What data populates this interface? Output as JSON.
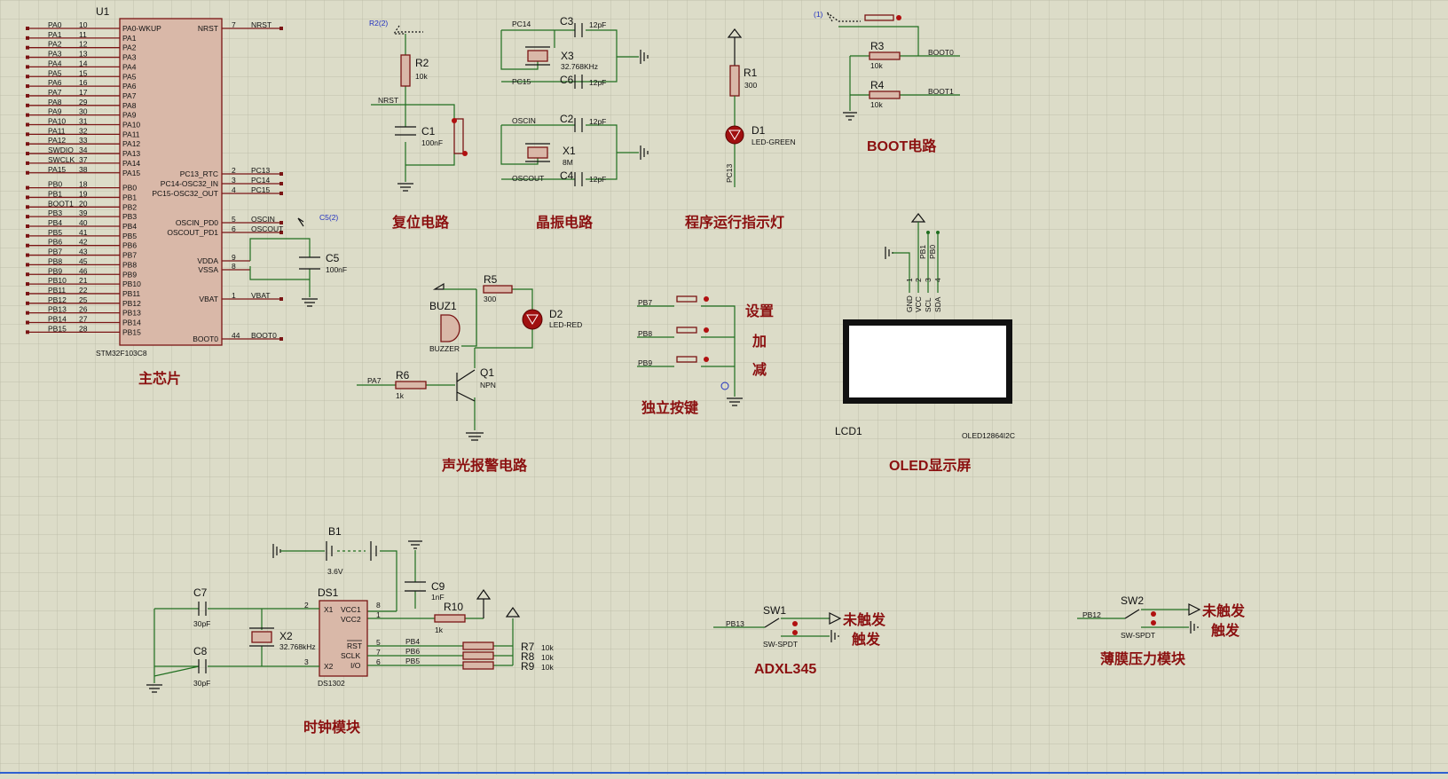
{
  "mcu": {
    "ref": "U1",
    "part": "STM32F103C8",
    "left_pins": [
      {
        "net": "PA0",
        "num": "10",
        "name": "PA0-WKUP"
      },
      {
        "net": "PA1",
        "num": "11",
        "name": "PA1"
      },
      {
        "net": "PA2",
        "num": "12",
        "name": "PA2"
      },
      {
        "net": "PA3",
        "num": "13",
        "name": "PA3"
      },
      {
        "net": "PA4",
        "num": "14",
        "name": "PA4"
      },
      {
        "net": "PA5",
        "num": "15",
        "name": "PA5"
      },
      {
        "net": "PA6",
        "num": "16",
        "name": "PA6"
      },
      {
        "net": "PA7",
        "num": "17",
        "name": "PA7"
      },
      {
        "net": "PA8",
        "num": "29",
        "name": "PA8"
      },
      {
        "net": "PA9",
        "num": "30",
        "name": "PA9"
      },
      {
        "net": "PA10",
        "num": "31",
        "name": "PA10"
      },
      {
        "net": "PA11",
        "num": "32",
        "name": "PA11"
      },
      {
        "net": "PA12",
        "num": "33",
        "name": "PA12"
      },
      {
        "net": "SWDIO",
        "num": "34",
        "name": "PA13"
      },
      {
        "net": "SWCLK",
        "num": "37",
        "name": "PA14"
      },
      {
        "net": "PA15",
        "num": "38",
        "name": "PA15"
      },
      {
        "net": "PB0",
        "num": "18",
        "name": "PB0"
      },
      {
        "net": "PB1",
        "num": "19",
        "name": "PB1"
      },
      {
        "net": "BOOT1",
        "num": "20",
        "name": "PB2"
      },
      {
        "net": "PB3",
        "num": "39",
        "name": "PB3"
      },
      {
        "net": "PB4",
        "num": "40",
        "name": "PB4"
      },
      {
        "net": "PB5",
        "num": "41",
        "name": "PB5"
      },
      {
        "net": "PB6",
        "num": "42",
        "name": "PB6"
      },
      {
        "net": "PB7",
        "num": "43",
        "name": "PB7"
      },
      {
        "net": "PB8",
        "num": "45",
        "name": "PB8"
      },
      {
        "net": "PB9",
        "num": "46",
        "name": "PB9"
      },
      {
        "net": "PB10",
        "num": "21",
        "name": "PB10"
      },
      {
        "net": "PB11",
        "num": "22",
        "name": "PB11"
      },
      {
        "net": "PB12",
        "num": "25",
        "name": "PB12"
      },
      {
        "net": "PB13",
        "num": "26",
        "name": "PB13"
      },
      {
        "net": "PB14",
        "num": "27",
        "name": "PB14"
      },
      {
        "net": "PB15",
        "num": "28",
        "name": "PB15"
      }
    ],
    "right_pins": [
      {
        "name": "NRST",
        "num": "7",
        "net": "NRST"
      },
      {
        "name": "PC13_RTC",
        "num": "2",
        "net": "PC13"
      },
      {
        "name": "PC14-OSC32_IN",
        "num": "3",
        "net": "PC14"
      },
      {
        "name": "PC15-OSC32_OUT",
        "num": "4",
        "net": "PC15"
      },
      {
        "name": "OSCIN_PD0",
        "num": "5",
        "net": "OSCIN"
      },
      {
        "name": "OSCOUT_PD1",
        "num": "6",
        "net": "OSCOUT"
      },
      {
        "name": "VDDA",
        "num": "9",
        "net": ""
      },
      {
        "name": "VSSA",
        "num": "8",
        "net": ""
      },
      {
        "name": "VBAT",
        "num": "1",
        "net": "VBAT"
      },
      {
        "name": "BOOT0",
        "num": "44",
        "net": "BOOT0"
      }
    ],
    "c5": {
      "ref": "C5",
      "value": "100nF",
      "probe": "C5(2)"
    }
  },
  "reset": {
    "r_ref": "R2",
    "r_val": "10k",
    "c_ref": "C1",
    "c_val": "100nF",
    "net": "NRST",
    "probe": "R2(2)"
  },
  "crystal": {
    "c3": {
      "ref": "C3",
      "val": "12pF"
    },
    "x3": {
      "ref": "X3",
      "val": "32.768KHz"
    },
    "c6": {
      "ref": "C6",
      "val": "12pF"
    },
    "c2": {
      "ref": "C2",
      "val": "12pF"
    },
    "x1": {
      "ref": "X1",
      "val": "8M"
    },
    "c4": {
      "ref": "C4",
      "val": "12pF"
    },
    "nets": {
      "pc14": "PC14",
      "pc15": "PC15",
      "oscin": "OSCIN",
      "oscout": "OSCOUT"
    }
  },
  "led_run": {
    "r_ref": "R1",
    "r_val": "300",
    "d_ref": "D1",
    "d_val": "LED-GREEN",
    "net": "PC13"
  },
  "boot": {
    "probe": "(1)",
    "r3": {
      "ref": "R3",
      "val": "10k"
    },
    "r4": {
      "ref": "R4",
      "val": "10k"
    },
    "net0": "BOOT0",
    "net1": "BOOT1"
  },
  "oled": {
    "ref": "LCD1",
    "part": "OLED12864I2C",
    "pins": [
      "GND",
      "VCC",
      "SCL",
      "SDA"
    ],
    "pin_nums": [
      "1",
      "2",
      "3",
      "4"
    ],
    "nets": [
      "PB1",
      "PB0"
    ]
  },
  "alarm": {
    "r5": {
      "ref": "R5",
      "val": "300"
    },
    "d2": {
      "ref": "D2",
      "val": "LED-RED"
    },
    "buz": {
      "ref": "BUZ1",
      "val": "BUZZER"
    },
    "r6": {
      "ref": "R6",
      "val": "1k"
    },
    "q1": {
      "ref": "Q1",
      "val": "NPN"
    },
    "net": "PA7"
  },
  "keys": {
    "nets": [
      "PB7",
      "PB8",
      "PB9"
    ],
    "labels": [
      "设置",
      "加",
      "减"
    ]
  },
  "clock": {
    "b1": {
      "ref": "B1",
      "val": "3.6V"
    },
    "c7": {
      "ref": "C7",
      "val": "30pF"
    },
    "c8": {
      "ref": "C8",
      "val": "30pF"
    },
    "x2": {
      "ref": "X2",
      "val": "32.768kHz"
    },
    "ds": {
      "ref": "DS1",
      "part": "DS1302"
    },
    "c9": {
      "ref": "C9",
      "val": "1nF"
    },
    "r10": {
      "ref": "R10",
      "val": "1k"
    },
    "r7": {
      "ref": "R7",
      "val": "10k"
    },
    "r8": {
      "ref": "R8",
      "val": "10k"
    },
    "r9": {
      "ref": "R9",
      "val": "10k"
    },
    "pins_left": [
      {
        "name": "X1",
        "num": "2"
      },
      {
        "name": "X2",
        "num": "3"
      }
    ],
    "pins_right": [
      {
        "name": "VCC1",
        "num": "8"
      },
      {
        "name": "VCC2",
        "num": "1"
      },
      {
        "name": "RST",
        "num": "5"
      },
      {
        "name": "SCLK",
        "num": "7"
      },
      {
        "name": "I/O",
        "num": "6"
      }
    ],
    "nets": [
      "PB4",
      "PB6",
      "PB5"
    ]
  },
  "sw1": {
    "ref": "SW1",
    "val": "SW-SPDT",
    "net": "PB13",
    "on": "未触发",
    "off": "触发"
  },
  "sw2": {
    "ref": "SW2",
    "val": "SW-SPDT",
    "net": "PB12",
    "on": "未触发",
    "off": "触发"
  },
  "titles": {
    "mcu": "主芯片",
    "reset": "复位电路",
    "crystal": "晶振电路",
    "led": "程序运行指示灯",
    "boot": "BOOT电路",
    "alarm": "声光报警电路",
    "keys": "独立按键",
    "oled": "OLED显示屏",
    "clock": "时钟模块",
    "adxl": "ADXL345",
    "film": "薄膜压力模块"
  }
}
